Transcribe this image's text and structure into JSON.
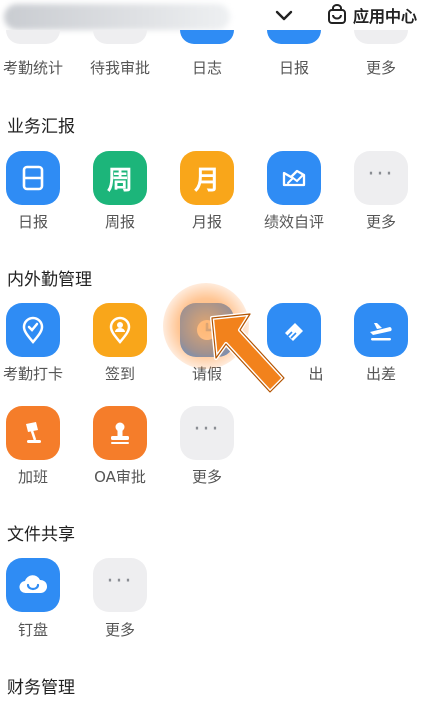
{
  "header": {
    "chevron_icon": "chevron-down-icon",
    "app_center_icon": "bag-icon",
    "app_center_label": "应用中心"
  },
  "top_row": [
    {
      "label": "考勤统计"
    },
    {
      "label": "待我审批"
    },
    {
      "label": "日志"
    },
    {
      "label": "日报"
    },
    {
      "label": "更多"
    }
  ],
  "sections": [
    {
      "title": "业务汇报",
      "items": [
        {
          "label": "日报",
          "glyph": "日",
          "icon": "daily-report-icon"
        },
        {
          "label": "周报",
          "glyph": "周",
          "icon": "weekly-report-icon"
        },
        {
          "label": "月报",
          "glyph": "月",
          "icon": "monthly-report-icon"
        },
        {
          "label": "绩效自评",
          "icon": "chart-trend-icon"
        },
        {
          "label": "更多",
          "glyph": "···",
          "icon": "more-icon"
        }
      ]
    },
    {
      "title": "内外勤管理",
      "items": [
        {
          "label": "考勤打卡",
          "icon": "location-check-icon"
        },
        {
          "label": "签到",
          "icon": "location-user-icon"
        },
        {
          "label": "请假",
          "icon": "clock-icon"
        },
        {
          "label": "出",
          "icon": "eraser-icon"
        },
        {
          "label": "出差",
          "icon": "airplane-icon"
        },
        {
          "label": "加班",
          "icon": "desk-lamp-icon"
        },
        {
          "label": "OA审批",
          "icon": "stamp-icon"
        },
        {
          "label": "更多",
          "glyph": "···",
          "icon": "more-icon"
        }
      ]
    },
    {
      "title": "文件共享",
      "items": [
        {
          "label": "钉盘",
          "icon": "cloud-icon"
        },
        {
          "label": "更多",
          "glyph": "···",
          "icon": "more-icon"
        }
      ]
    },
    {
      "title": "财务管理",
      "items": []
    }
  ],
  "overlay": {
    "highlight_target": "请假",
    "arrow_icon": "pointer-arrow-icon",
    "colors": {
      "highlight": "#f79a3e",
      "arrow": "#f2821c"
    }
  },
  "colors": {
    "blue": "#2f8cf4",
    "green": "#1cb57a",
    "amber": "#f9a61a",
    "orange": "#f57d2a",
    "gray": "#eeeef0"
  }
}
